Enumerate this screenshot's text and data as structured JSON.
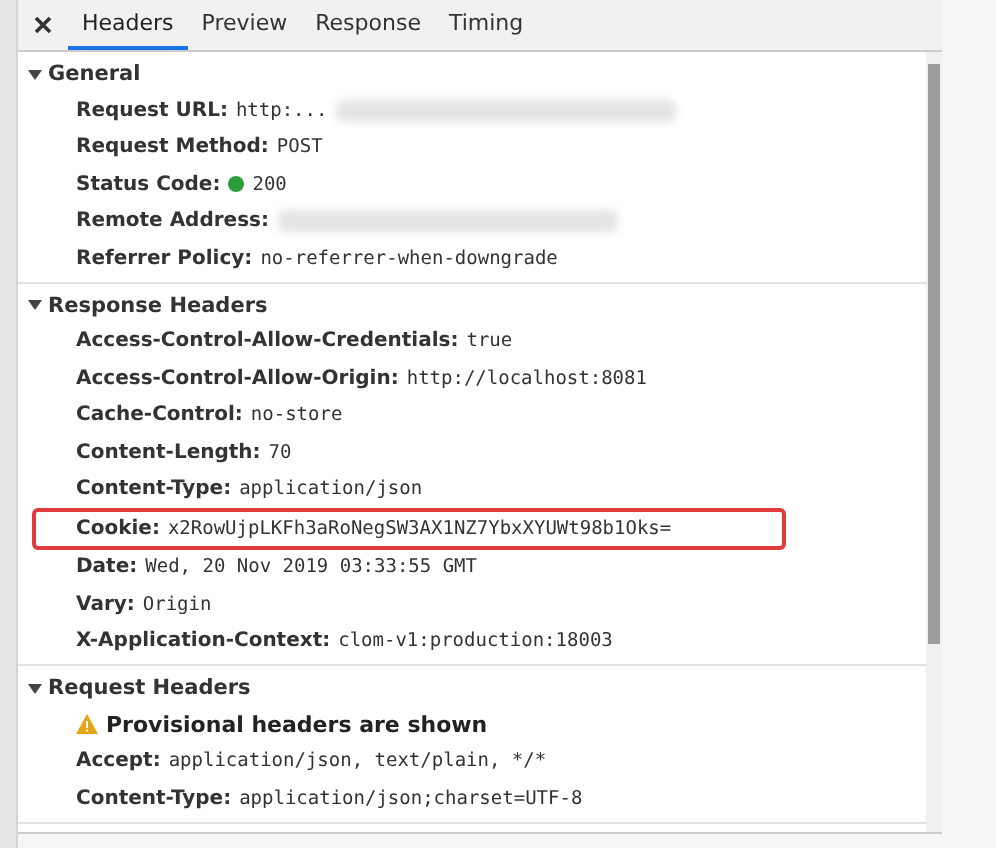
{
  "tabs": [
    {
      "label": "Headers",
      "selected": true
    },
    {
      "label": "Preview",
      "selected": false
    },
    {
      "label": "Response",
      "selected": false
    },
    {
      "label": "Timing",
      "selected": false
    }
  ],
  "sections": [
    {
      "title": "General",
      "expanded": true,
      "rows": [
        {
          "kind": "field",
          "name": "Request URL:",
          "value": "http:...",
          "redacted": true
        },
        {
          "kind": "field",
          "name": "Request Method:",
          "value": "POST"
        },
        {
          "kind": "field",
          "name": "Status Code:",
          "value": "200",
          "color": "#2e9e3a"
        },
        {
          "kind": "field",
          "name": "Remote Address:",
          "redacted": true
        },
        {
          "kind": "field",
          "name": "Referrer Policy:",
          "value": "no-referrer-when-downgrade"
        }
      ]
    },
    {
      "title": "Response Headers",
      "expanded": true,
      "rows": [
        {
          "kind": "field",
          "name": "Access-Control-Allow-Credentials:",
          "value": "true"
        },
        {
          "kind": "field",
          "name": "Access-Control-Allow-Origin:",
          "value": "http://localhost:8081"
        },
        {
          "kind": "field",
          "name": "Cache-Control:",
          "value": "no-store"
        },
        {
          "kind": "field",
          "name": "Content-Length:",
          "value": "70"
        },
        {
          "kind": "field",
          "name": "Content-Type:",
          "value": "application/json"
        },
        {
          "kind": "field",
          "name": "Cookie:",
          "value": "x2RowUjpLKFh3aRoNegSW3AX1NZ7YbxXYUWt98b1Oks=",
          "highlighted": true
        },
        {
          "kind": "field",
          "name": "Date:",
          "value": "Wed, 20 Nov 2019 03:33:55 GMT"
        },
        {
          "kind": "field",
          "name": "Vary:",
          "value": "Origin"
        },
        {
          "kind": "field",
          "name": "X-Application-Context:",
          "value": "clom-v1:production:18003"
        }
      ]
    },
    {
      "title": "Request Headers",
      "expanded": true,
      "rows": [
        {
          "kind": "warning",
          "name": "Provisional headers are shown"
        },
        {
          "kind": "field",
          "name": "Accept:",
          "value": "application/json, text/plain, */*"
        },
        {
          "kind": "field",
          "name": "Content-Type:",
          "value": "application/json;charset=UTF-8"
        }
      ]
    }
  ]
}
